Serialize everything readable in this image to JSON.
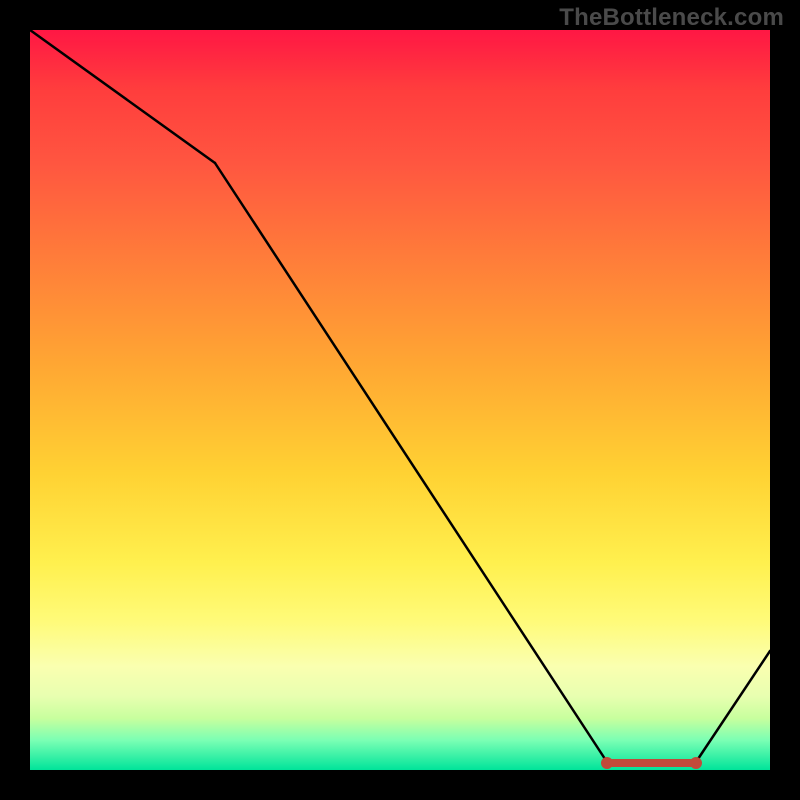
{
  "watermark": "TheBottleneck.com",
  "chart_data": {
    "type": "line",
    "title": "",
    "xlabel": "",
    "ylabel": "",
    "xlim": [
      0,
      100
    ],
    "ylim": [
      0,
      100
    ],
    "x": [
      0,
      25,
      78,
      90,
      100
    ],
    "values": [
      100,
      82,
      0,
      0,
      15
    ],
    "highlight_band": {
      "x_start": 78,
      "x_end": 90,
      "y": 0
    },
    "background_gradient": {
      "top": "#ff1744",
      "mid": "#ffea3a",
      "bottom": "#00e49a"
    }
  }
}
